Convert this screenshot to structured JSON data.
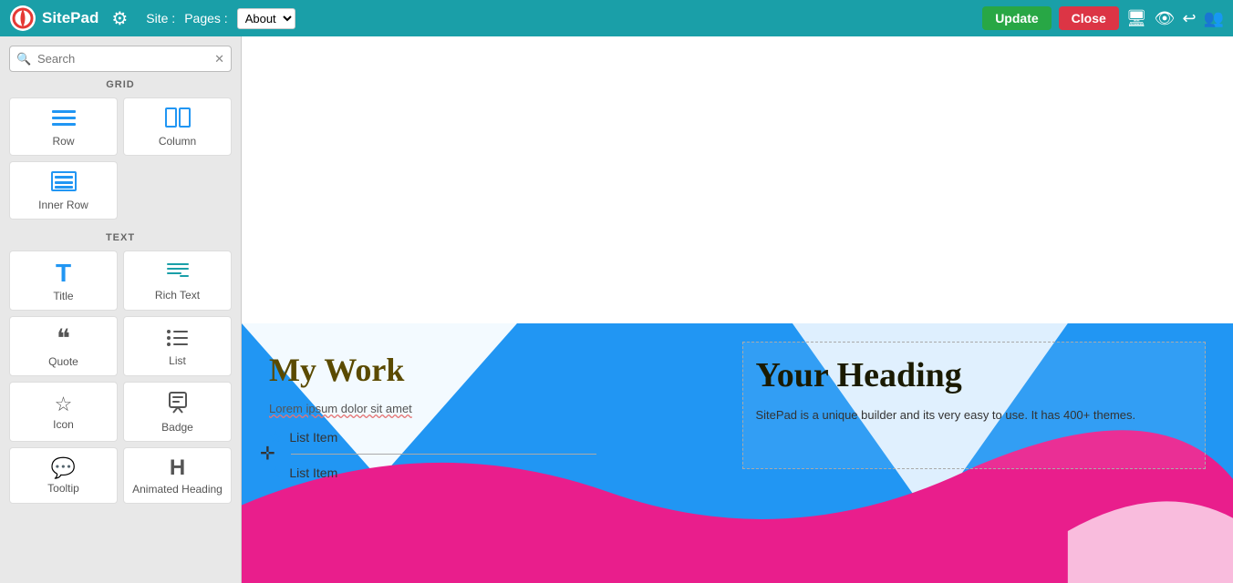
{
  "topbar": {
    "logo_text": "SitePad",
    "site_label": "Site :",
    "pages_label": "Pages :",
    "page_select": "About",
    "update_label": "Update",
    "close_label": "Close",
    "gear_icon": "⚙",
    "monitor_icon": "🖥",
    "eye_icon": "👁",
    "undo_icon": "↩",
    "users_icon": "👥"
  },
  "sidebar": {
    "search_placeholder": "Search",
    "clear_icon": "✕",
    "sections": [
      {
        "label": "GRID",
        "widgets": [
          {
            "id": "row",
            "icon": "≡",
            "icon_class": "blue",
            "label": "Row"
          },
          {
            "id": "column",
            "icon": "⬜",
            "icon_class": "blue",
            "label": "Column"
          },
          {
            "id": "inner-row",
            "icon": "⊞",
            "icon_class": "blue",
            "label": "Inner Row"
          }
        ]
      },
      {
        "label": "TEXT",
        "widgets": [
          {
            "id": "title",
            "icon": "T",
            "icon_class": "blue",
            "label": "Title"
          },
          {
            "id": "rich-text",
            "icon": "≡",
            "icon_class": "teal",
            "label": "Rich Text"
          },
          {
            "id": "quote",
            "icon": "❝",
            "icon_class": "",
            "label": "Quote"
          },
          {
            "id": "list",
            "icon": "☰",
            "icon_class": "",
            "label": "List"
          },
          {
            "id": "icon",
            "icon": "★",
            "icon_class": "",
            "label": "Icon"
          },
          {
            "id": "badge",
            "icon": "🪪",
            "icon_class": "",
            "label": "Badge"
          },
          {
            "id": "tooltip",
            "icon": "💬",
            "icon_class": "",
            "label": "Tooltip"
          },
          {
            "id": "animated-heading",
            "icon": "H",
            "icon_class": "",
            "label": "Animated Heading"
          }
        ]
      }
    ]
  },
  "canvas": {
    "my_work_heading": "My Work",
    "lorem_text": "Lorem ipsum dolor sit amet",
    "list_items": [
      "List Item",
      "List Item"
    ],
    "your_heading": "Your Heading",
    "your_heading_text": "SitePad is a unique builder and its very easy to use. It has 400+ themes."
  }
}
